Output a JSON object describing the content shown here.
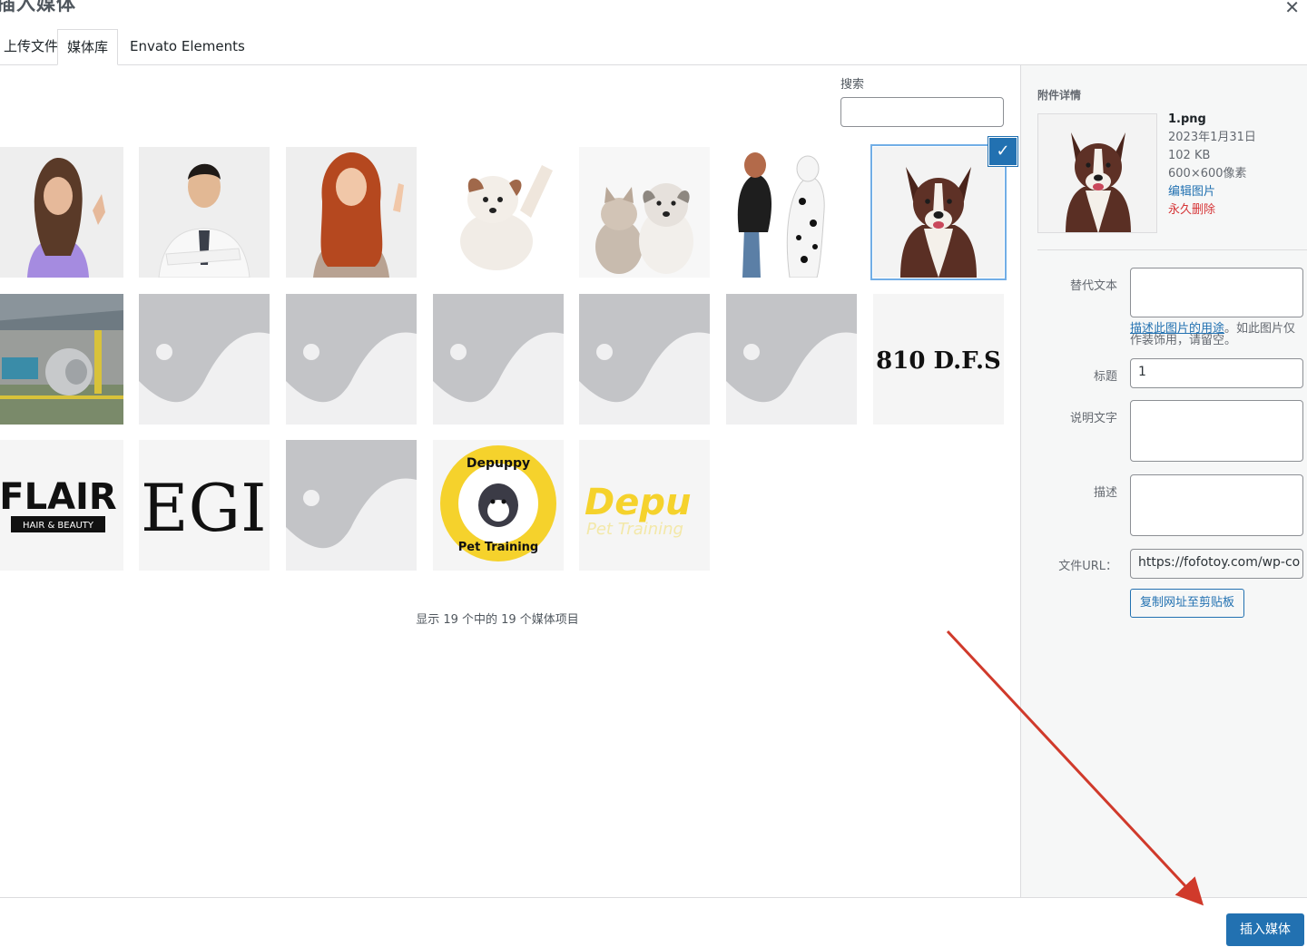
{
  "modal": {
    "title": "插入媒体",
    "close_icon": "close-icon"
  },
  "tabs": [
    {
      "label": "上传文件"
    },
    {
      "label": "媒体库"
    },
    {
      "label": "Envato Elements"
    }
  ],
  "search": {
    "label": "搜索",
    "value": ""
  },
  "media_items": [
    {
      "kind": "photo-woman-purple"
    },
    {
      "kind": "photo-doctor"
    },
    {
      "kind": "photo-redhead-woman"
    },
    {
      "kind": "photo-puppy-paw"
    },
    {
      "kind": "photo-kitten-puppy"
    },
    {
      "kind": "photo-woman-dalmatian"
    },
    {
      "kind": "photo-brown-dog",
      "selected": true
    },
    {
      "kind": "photo-factory"
    },
    {
      "kind": "placeholder"
    },
    {
      "kind": "placeholder"
    },
    {
      "kind": "placeholder"
    },
    {
      "kind": "placeholder"
    },
    {
      "kind": "placeholder"
    },
    {
      "kind": "logo-810",
      "text": "810 D.F.S"
    },
    {
      "kind": "logo-flair",
      "text": "FLAIR",
      "subtext": "HAIR & BEAUTY"
    },
    {
      "kind": "logo-egi",
      "text": "EGI"
    },
    {
      "kind": "placeholder"
    },
    {
      "kind": "logo-depuppy-circle",
      "text": "Depuppy",
      "subtext": "Pet Training"
    },
    {
      "kind": "logo-depuppy-text",
      "text": "Depu",
      "subtext": "Pet Training"
    }
  ],
  "status": {
    "count_text": "显示 19 个中的 19 个媒体项目"
  },
  "attachment": {
    "section_title": "附件详情",
    "filename": "1.png",
    "date": "2023年1月31日",
    "size": "102 KB",
    "dimensions": "600×600像素",
    "edit_link": "编辑图片",
    "delete_link": "永久删除",
    "alt_label": "替代文本",
    "alt_value": "",
    "alt_help_link": "描述此图片的用途",
    "alt_help_rest": "。如此图片仅作装饰用，请留空。",
    "title_label": "标题",
    "title_value": "1",
    "caption_label": "说明文字",
    "caption_value": "",
    "description_label": "描述",
    "description_value": "",
    "url_label": "文件URL：",
    "url_value": "https://fofotoy.com/wp-co",
    "copy_button": "复制网址至剪贴板"
  },
  "toolbar": {
    "insert_button": "插入媒体"
  },
  "colors": {
    "accent": "#2271b1",
    "danger": "#d63638",
    "annotation_arrow": "#d03a2b",
    "selection_ring": "#72aee6"
  }
}
